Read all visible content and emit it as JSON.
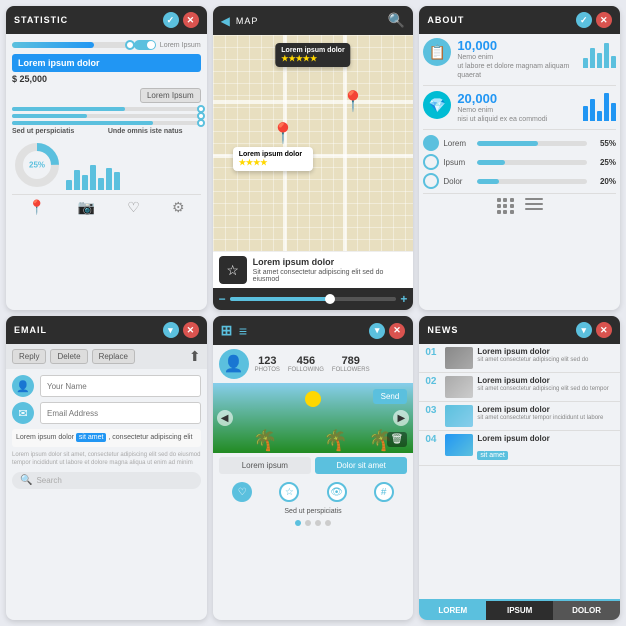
{
  "panels": {
    "statistic": {
      "title": "STATISTIC",
      "main_text": "Lorem ipsum dolor",
      "price": "$ 25,000",
      "button_label": "Lorem Ipsum",
      "percent": "25%",
      "text_col1": "Sed ut perspiciatis",
      "text_col2": "Unde omnis iste natus",
      "icons": [
        "📍",
        "📷",
        "♡",
        "⚙"
      ]
    },
    "map": {
      "title": "MAP",
      "callout1": "Lorem ipsum dolor",
      "callout2": "Lorem ipsum dolor",
      "stars1": "★★★★★",
      "stars2": "★★★★",
      "card_title": "Lorem ipsum dolor",
      "card_text": "Sit amet consectetur adipiscing elit sed do eiusmod"
    },
    "about": {
      "title": "About",
      "nemo1": "Nemo enim",
      "desc1": "ut labore et dolore magnam aliquam quaerat",
      "num1": "10,000",
      "nemo2": "Nemo enim",
      "desc2": "nisi ut aliquid ex ea commodi",
      "num2": "20,000",
      "lorem_label": "Lorem",
      "ipsum_label": "Ipsum",
      "dolor_label": "Dolor",
      "pct1": "55%",
      "pct2": "25%",
      "pct3": "20%"
    },
    "email": {
      "title": "EMAIL",
      "btn_reply": "Reply",
      "btn_delete": "Delete",
      "btn_replace": "Replace",
      "placeholder_name": "Your Name",
      "placeholder_email": "Email Address",
      "body_text": "Lorem ipsum dolor sit amet, consectetur adipiscing elit",
      "highlight_text": "sit amet",
      "footer_text": "Lorem ipsum dolor sit amet, consectetur adipiscing elit sed do eiusmod tempor incididunt ut labore et dolore magna aliqua ut enim ad minim",
      "search_placeholder": "Search"
    },
    "social": {
      "photos_label": "PHOTOS",
      "photos_num": "123",
      "following_label": "FOLLOWING",
      "following_num": "456",
      "followers_label": "FOLLOWERS",
      "followers_num": "789",
      "btn_send": "Send",
      "btn_lorem": "Lorem ipsum",
      "btn_dolor": "Dolor sit amet",
      "sub_text": "Sed ut perspiciatis",
      "dots": 4
    },
    "news": {
      "title": "NEWS",
      "items": [
        {
          "num": "01",
          "title": "Lorem ipsum dolor",
          "body": "sit amet consectetur adipiscing elit sed do eiusmod tempor"
        },
        {
          "num": "02",
          "title": "Lorem ipsum dolor",
          "body": "sit amet consectetur adipiscing elit sed"
        },
        {
          "num": "03",
          "title": "Lorem ipsum dolor",
          "body": "sit amet consectetur adipiscing tempor incididunt ut labore"
        },
        {
          "num": "04",
          "title": "Lorem ipsum dolor",
          "body": "sit amet",
          "tag": "sit amet"
        }
      ],
      "footer_btns": [
        "LOREM",
        "IPSUM",
        "DOLOR"
      ]
    }
  }
}
